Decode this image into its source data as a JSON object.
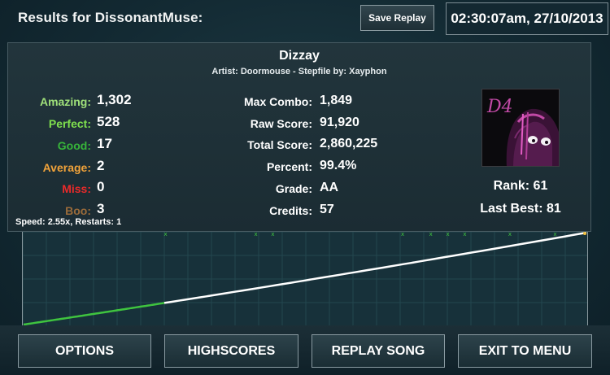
{
  "header": {
    "results_title": "Results for DissonantMuse:",
    "save_replay_label": "Save Replay",
    "datetime": "02:30:07am, 27/10/2013"
  },
  "song": {
    "title": "Dizzay",
    "meta": "Artist: Doormouse  -  Stepfile by: Xayphon"
  },
  "judgements": [
    {
      "label": "Amazing:",
      "value": "1,302",
      "color": "#9fe07a"
    },
    {
      "label": "Perfect:",
      "value": "528",
      "color": "#7fe04e"
    },
    {
      "label": "Good:",
      "value": "17",
      "color": "#37b53a"
    },
    {
      "label": "Average:",
      "value": "2",
      "color": "#f0a23a"
    },
    {
      "label": "Miss:",
      "value": "0",
      "color": "#ea2a2a"
    },
    {
      "label": "Boo:",
      "value": "3",
      "color": "#9a6b3a"
    }
  ],
  "speed_line": "Speed: 2.55x, Restarts: 1",
  "stats": [
    {
      "label": "Max Combo:",
      "value": "1,849"
    },
    {
      "label": "Raw Score:",
      "value": "91,920"
    },
    {
      "label": "Total Score:",
      "value": "2,860,225"
    },
    {
      "label": "Percent:",
      "value": "99.4%"
    },
    {
      "label": "Grade:",
      "value": "AA"
    },
    {
      "label": "Credits:",
      "value": "57"
    }
  ],
  "avatar": {
    "logo_text": "D4"
  },
  "rank": {
    "rank_line": "Rank: 61",
    "last_best_line": "Last Best: 81"
  },
  "graph": {
    "progress_start": 0,
    "progress_end": 1,
    "green_until": 0.25,
    "colors": {
      "good": "#3fc43f",
      "normal": "#ffffff",
      "marker": "#3fc43f"
    }
  },
  "menu": {
    "options": "OPTIONS",
    "highscores": "HIGHSCORES",
    "replay_song": "REPLAY SONG",
    "exit_to_menu": "EXIT TO MENU"
  }
}
